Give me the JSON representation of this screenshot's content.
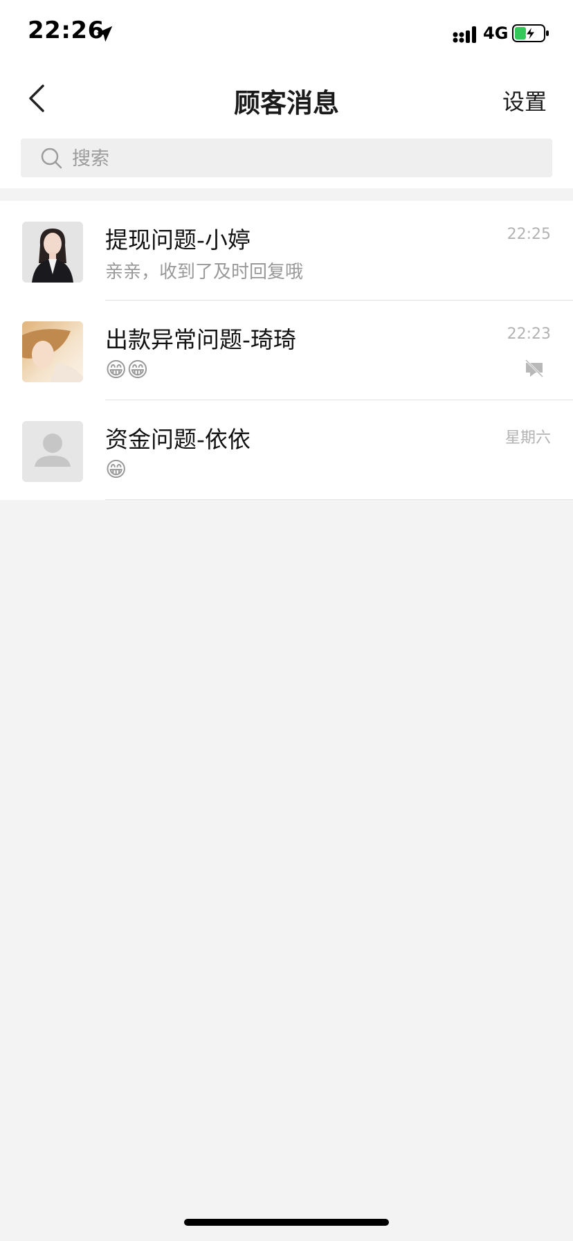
{
  "status_bar": {
    "time": "22:26",
    "network": "4G",
    "icons": [
      "location-arrow-icon",
      "signal-icon",
      "battery-charging-icon"
    ]
  },
  "header": {
    "title": "顾客消息",
    "settings_label": "设置",
    "back_icon": "chevron-left-icon"
  },
  "search": {
    "placeholder": "搜索",
    "icon": "search-icon"
  },
  "chats": [
    {
      "name": "提现问题-小婷",
      "preview": "亲亲，收到了及时回复哦",
      "time": "22:25",
      "muted": false
    },
    {
      "name": "出款异常问题-琦琦",
      "preview": "😁😁",
      "time": "22:23",
      "muted": true
    },
    {
      "name": "资金问题-依依",
      "preview": "😁",
      "time": "星期六",
      "muted": false
    }
  ],
  "colors": {
    "background": "#f3f3f3",
    "surface": "#ffffff",
    "muted_text": "#999999",
    "battery_green": "#34c759"
  }
}
